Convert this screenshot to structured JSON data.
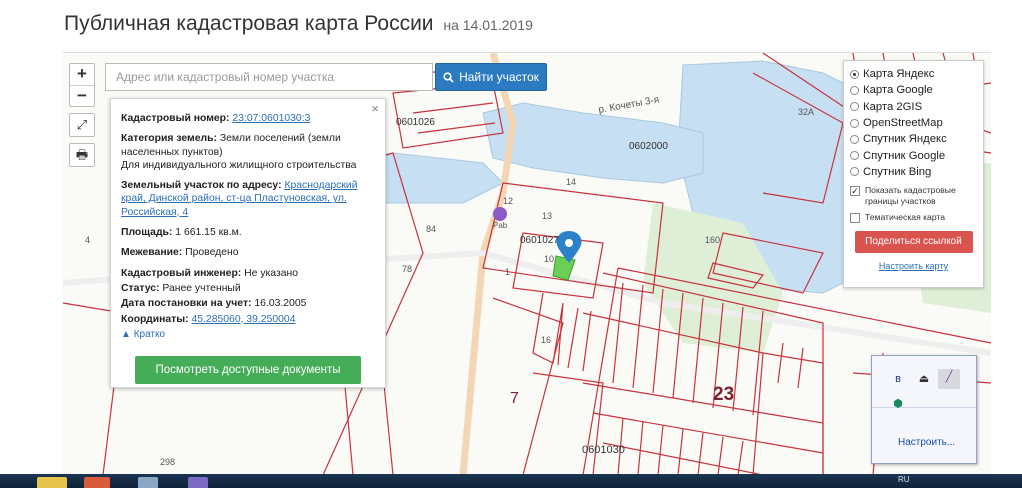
{
  "page": {
    "title": "Публичная кадастровая карта России",
    "date": "на 14.01.2019"
  },
  "map_controls": {
    "zoom_in": "+",
    "zoom_out": "−"
  },
  "search": {
    "placeholder": "Адрес или кадастровый номер участка",
    "button_label": "Найти участок"
  },
  "info": {
    "cadastral_number_label": "Кадастровый номер:",
    "cadastral_number": "23:07:0601030:3",
    "category_label": "Категория земель:",
    "category": "Земли поселений (земли населенных пунктов)",
    "permitted_use": "Для индивидуального жилищного строительства",
    "address_label": "Земельный участок по адресу:",
    "address": "Краснодарский край, Динской район, ст-ца Пластуновская, ул. Российская, 4",
    "area_label": "Площадь:",
    "area": "1 661.15 кв.м.",
    "survey_label": "Межевание:",
    "survey": "Проведено",
    "engineer_label": "Кадастровый инженер:",
    "engineer": "Не указано",
    "status_label": "Статус:",
    "status": "Ранее учтенный",
    "reg_date_label": "Дата постановки на учет:",
    "reg_date": "16.03.2005",
    "coords_label": "Координаты:",
    "coords": "45.285060, 39.250004",
    "collapse_label": "Кратко",
    "docs_button": "Посмотреть доступные документы",
    "close": "×"
  },
  "layers": {
    "options": [
      {
        "label": "Карта Яндекс",
        "selected": true
      },
      {
        "label": "Карта Google",
        "selected": false
      },
      {
        "label": "Карта 2GIS",
        "selected": false
      },
      {
        "label": "OpenStreetMap",
        "selected": false
      },
      {
        "label": "Спутник Яндекс",
        "selected": false
      },
      {
        "label": "Спутник Google",
        "selected": false
      },
      {
        "label": "Спутник Bing",
        "selected": false
      }
    ],
    "show_borders_label": "Показать кадастровые границы участков",
    "show_borders_checked": true,
    "thematic_label": "Тематическая карта",
    "thematic_checked": false,
    "share_button": "Поделиться ссылкой",
    "configure_link": "Настроить карту"
  },
  "map_labels": {
    "river": "р. Кочеты 3-я",
    "q1": "0601026",
    "q2": "0602000",
    "q3": "0601027",
    "q4": "0601030",
    "big23": "23",
    "big7": "7",
    "n4": "4",
    "n78": "78",
    "n298": "298",
    "n84": "84",
    "n14": "14",
    "n13": "13",
    "n12": "12",
    "n10": "10",
    "n160": "160",
    "n32a": "32А",
    "n16": "16",
    "n1": "1",
    "pharmacy": "Pab"
  },
  "extension": {
    "configure_label": "Настроить..."
  },
  "taskbar": {
    "lang": "RU"
  },
  "colors": {
    "parcel": "#c8323c",
    "water": "#c7dff2",
    "green": "#d3e8c8",
    "marker": "#2b82cb",
    "selected_parcel": "#6ccf55"
  }
}
